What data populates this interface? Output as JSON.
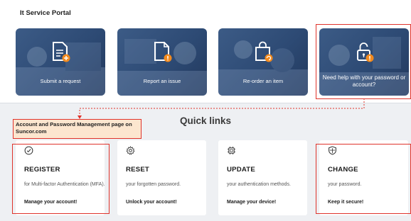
{
  "portal": {
    "title": "It Service Portal",
    "tiles": [
      {
        "label": "Submit a request",
        "icon": "document-plus-icon"
      },
      {
        "label": "Report an issue",
        "icon": "document-alert-icon"
      },
      {
        "label": "Re-order an item",
        "icon": "shopping-bag-refresh-icon"
      },
      {
        "label": "Need help with your password or account?",
        "icon": "unlock-alert-icon"
      }
    ]
  },
  "callout": {
    "text": "Account and Password Management page on Suncor.com"
  },
  "quick_links": {
    "title": "Quick links",
    "cards": [
      {
        "title": "REGISTER",
        "description": "for Multi-factor Authentication (MFA).",
        "link": "Manage your account!",
        "icon": "check-circle-icon"
      },
      {
        "title": "RESET",
        "description": "your forgotten password.",
        "link": "Unlock your account!",
        "icon": "gear-icon"
      },
      {
        "title": "UPDATE",
        "description": "your authentication methods.",
        "link": "Manage your device!",
        "icon": "chip-icon"
      },
      {
        "title": "CHANGE",
        "description": "your password.",
        "link": "Keep it secure!",
        "icon": "shield-icon"
      }
    ]
  },
  "colors": {
    "tile_blue": "#2d4a74",
    "highlight_red": "#e0332b",
    "callout_bg": "#fce6cf",
    "badge_orange": "#f28a1e",
    "page_bg": "#eef0f3"
  }
}
